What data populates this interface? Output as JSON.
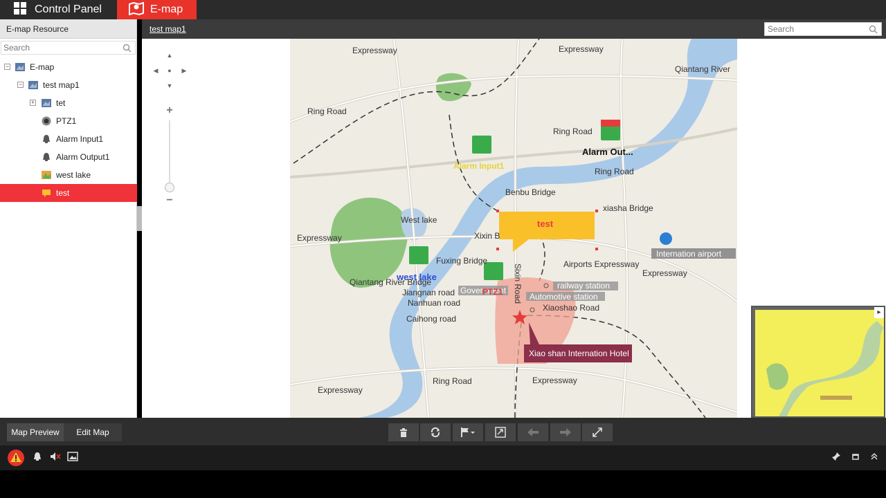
{
  "tabs": {
    "control_panel": "Control Panel",
    "emap": "E-map"
  },
  "resource": {
    "title": "E-map Resource",
    "search_placeholder": "Search",
    "tree": [
      {
        "label": "E-map",
        "expander": "−",
        "icon": "map-icon"
      },
      {
        "label": "test map1",
        "expander": "−",
        "icon": "map-icon"
      },
      {
        "label": "tet",
        "expander": "+",
        "icon": "map-icon"
      },
      {
        "label": "PTZ1",
        "expander": "",
        "icon": "ptz-camera-icon"
      },
      {
        "label": "Alarm Input1",
        "expander": "",
        "icon": "alarm-input-icon"
      },
      {
        "label": "Alarm Output1",
        "expander": "",
        "icon": "alarm-output-icon"
      },
      {
        "label": "west lake",
        "expander": "",
        "icon": "hot-region-icon"
      },
      {
        "label": "test",
        "expander": "",
        "icon": "hot-spot-icon",
        "selected": true
      }
    ]
  },
  "map": {
    "current_map": "test map1",
    "search_placeholder": "Search",
    "labels": {
      "expressway": "Expressway",
      "ring_road": "Ring Road",
      "qiantang_river": "Qiantang River",
      "alarm_out": "Alarm Out...",
      "alarm_input": "Alarm Input1",
      "benbu_bridge": "Benbu Bridge",
      "xiasha_bridge": "xiasha Bridge",
      "west_lake_map": "West lake",
      "xixin": "Xixin B",
      "test_hotspot": "test",
      "internation_airport": "Internation airport",
      "airports_expressway": "Airports Expressway",
      "fuxing_bridge": "Fuxing Bridge",
      "west_lake_region": "west lake",
      "qiantang_river_bridge": "Qiantang River Bridge",
      "jiangnan_road": "Jiangnan road",
      "nanhuan_road": "Nanhuan road",
      "caihong_road": "Caihong road",
      "government": "Government",
      "ptz1": "PTZ1",
      "sixin_road": "Sixin Road",
      "railway_station": "railway station",
      "automotive_station": "Automotive station",
      "xiaoshao_road": "Xiaoshao Road",
      "hotel": "Xiao shan Internation Hotel"
    }
  },
  "bottom": {
    "map_preview": "Map Preview",
    "edit_map": "Edit Map",
    "tools": [
      "delete-icon",
      "refresh-icon",
      "flag-icon",
      "zoom-fit-icon",
      "back-icon",
      "forward-icon",
      "fullscreen-icon"
    ]
  },
  "colors": {
    "accent": "#e8332b",
    "river": "#a9c9e8",
    "park": "#8fc47d",
    "hotspot": "#f9c02a",
    "region": "#f0a090",
    "overview": "#f3ef5a"
  }
}
